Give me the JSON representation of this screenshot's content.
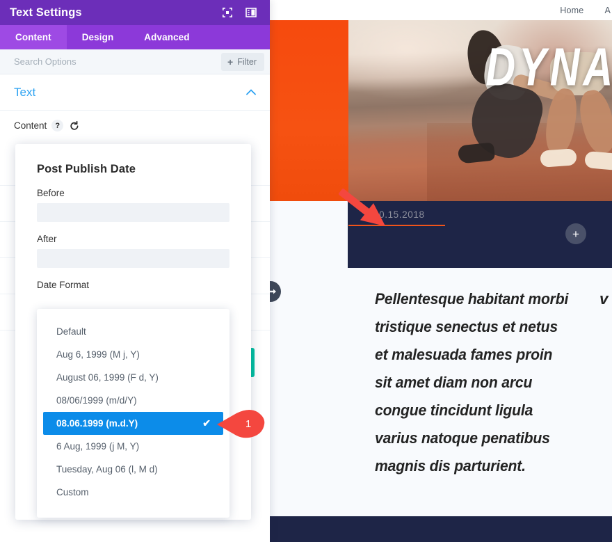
{
  "panel": {
    "title": "Text Settings",
    "header_icons": [
      {
        "name": "fullscreen-icon"
      },
      {
        "name": "layout-columns-icon"
      }
    ],
    "tabs": [
      {
        "label": "Content",
        "active": true
      },
      {
        "label": "Design",
        "active": false
      },
      {
        "label": "Advanced",
        "active": false
      }
    ],
    "search": {
      "placeholder": "Search Options",
      "value": ""
    },
    "filter_button": {
      "plus": "+",
      "label": "Filter"
    },
    "section": {
      "title": "Text",
      "collapse_icon": "chevron-up-icon",
      "field_label": "Content",
      "help_icon": "?",
      "reset_icon": "↺"
    },
    "actions": {
      "cancel_color": "#f0545a",
      "save_color": "#00bfa0"
    },
    "colors": {
      "header": "#6c2eb9",
      "tabbar": "#8c39d9",
      "tab_active": "#9e4ae4",
      "link": "#2ea3f2"
    }
  },
  "popup": {
    "title": "Post Publish Date",
    "fields": [
      {
        "label": "Before",
        "value": "",
        "placeholder": ""
      },
      {
        "label": "After",
        "value": "",
        "placeholder": ""
      },
      {
        "label": "Date Format",
        "value": "08.06.1999 (m.d.Y)",
        "placeholder": ""
      }
    ]
  },
  "dropdown": {
    "selected_index": 4,
    "options": [
      {
        "label": "Default"
      },
      {
        "label": "Aug 6, 1999 (M j, Y)"
      },
      {
        "label": "August 06, 1999 (F d, Y)"
      },
      {
        "label": "08/06/1999 (m/d/Y)"
      },
      {
        "label": "08.06.1999 (m.d.Y)"
      },
      {
        "label": "6 Aug, 1999 (j M, Y)"
      },
      {
        "label": "Tuesday, Aug 06 (l, M d)"
      },
      {
        "label": "Custom"
      }
    ],
    "check_glyph": "✔",
    "selected_color": "#0c8ce9"
  },
  "callout": {
    "number": "1",
    "color": "#f4473f"
  },
  "preview": {
    "nav": [
      {
        "label": "Home"
      },
      {
        "label": "A"
      }
    ],
    "hero": {
      "title": "DYNA",
      "accent_color": "#f6511a"
    },
    "post_date": "10.15.2018",
    "plus_button": "+",
    "paragraph": "Pellentesque habitant morbi tristique senectus et netus et malesuada fames proin sit amet diam non arcu congue tincidunt ligula varius natoque penatibus magnis dis parturient.",
    "paragraph_clipped": "v s s c a n n a n n",
    "band_color": "#1e2547"
  },
  "drag_handle": {
    "icon": "horizontal-resize-icon"
  }
}
